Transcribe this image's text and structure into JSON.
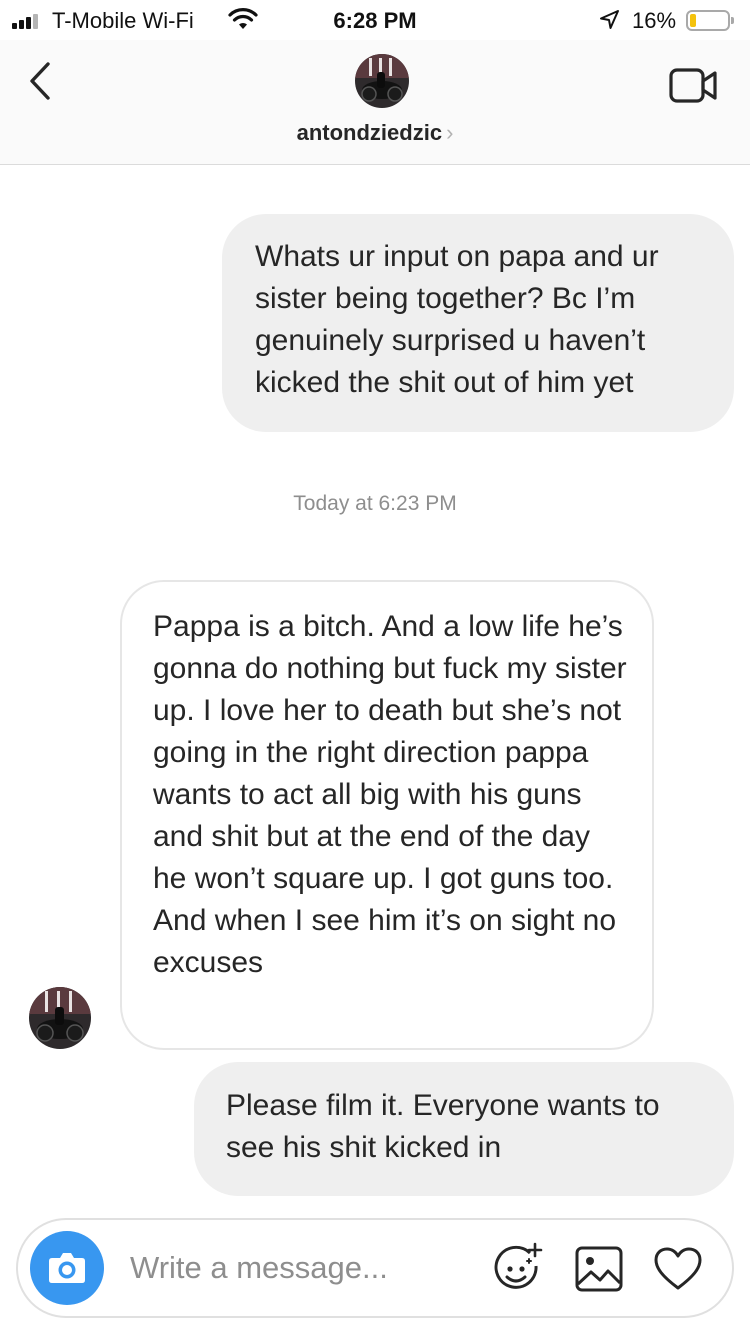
{
  "status_bar": {
    "carrier": "T-Mobile Wi-Fi",
    "time": "6:28 PM",
    "battery_percent": "16%",
    "battery_level": 0.16,
    "battery_color": "#f4c20d",
    "icons": [
      "signal-icon",
      "wifi-icon",
      "location-arrow-icon",
      "battery-icon"
    ]
  },
  "header": {
    "username": "antondziedzic",
    "chevron": "›",
    "icons": [
      "back-chevron-icon",
      "video-call-icon"
    ]
  },
  "thread": {
    "messages": [
      {
        "direction": "sent",
        "text": "Whats ur input on papa and ur sister being together? Bc I’m genuinely surprised u haven’t kicked the shit out of him yet"
      },
      {
        "direction": "received",
        "text": "Pappa is a bitch. And a low life he’s gonna do nothing but fuck my sister up. I love her to death but she’s not going in the right direction pappa wants to act all big with his guns and shit but at the end of the day he won’t square up. I got guns too. And when I see him it’s on sight no excuses"
      },
      {
        "direction": "sent",
        "text": "Please film it. Everyone wants to see his shit kicked in"
      }
    ],
    "timestamp": "Today at 6:23 PM"
  },
  "composer": {
    "placeholder": "Write a message...",
    "accent_color": "#3897f0",
    "icons": [
      "camera-icon",
      "sticker-icon",
      "gallery-icon",
      "heart-icon"
    ]
  }
}
